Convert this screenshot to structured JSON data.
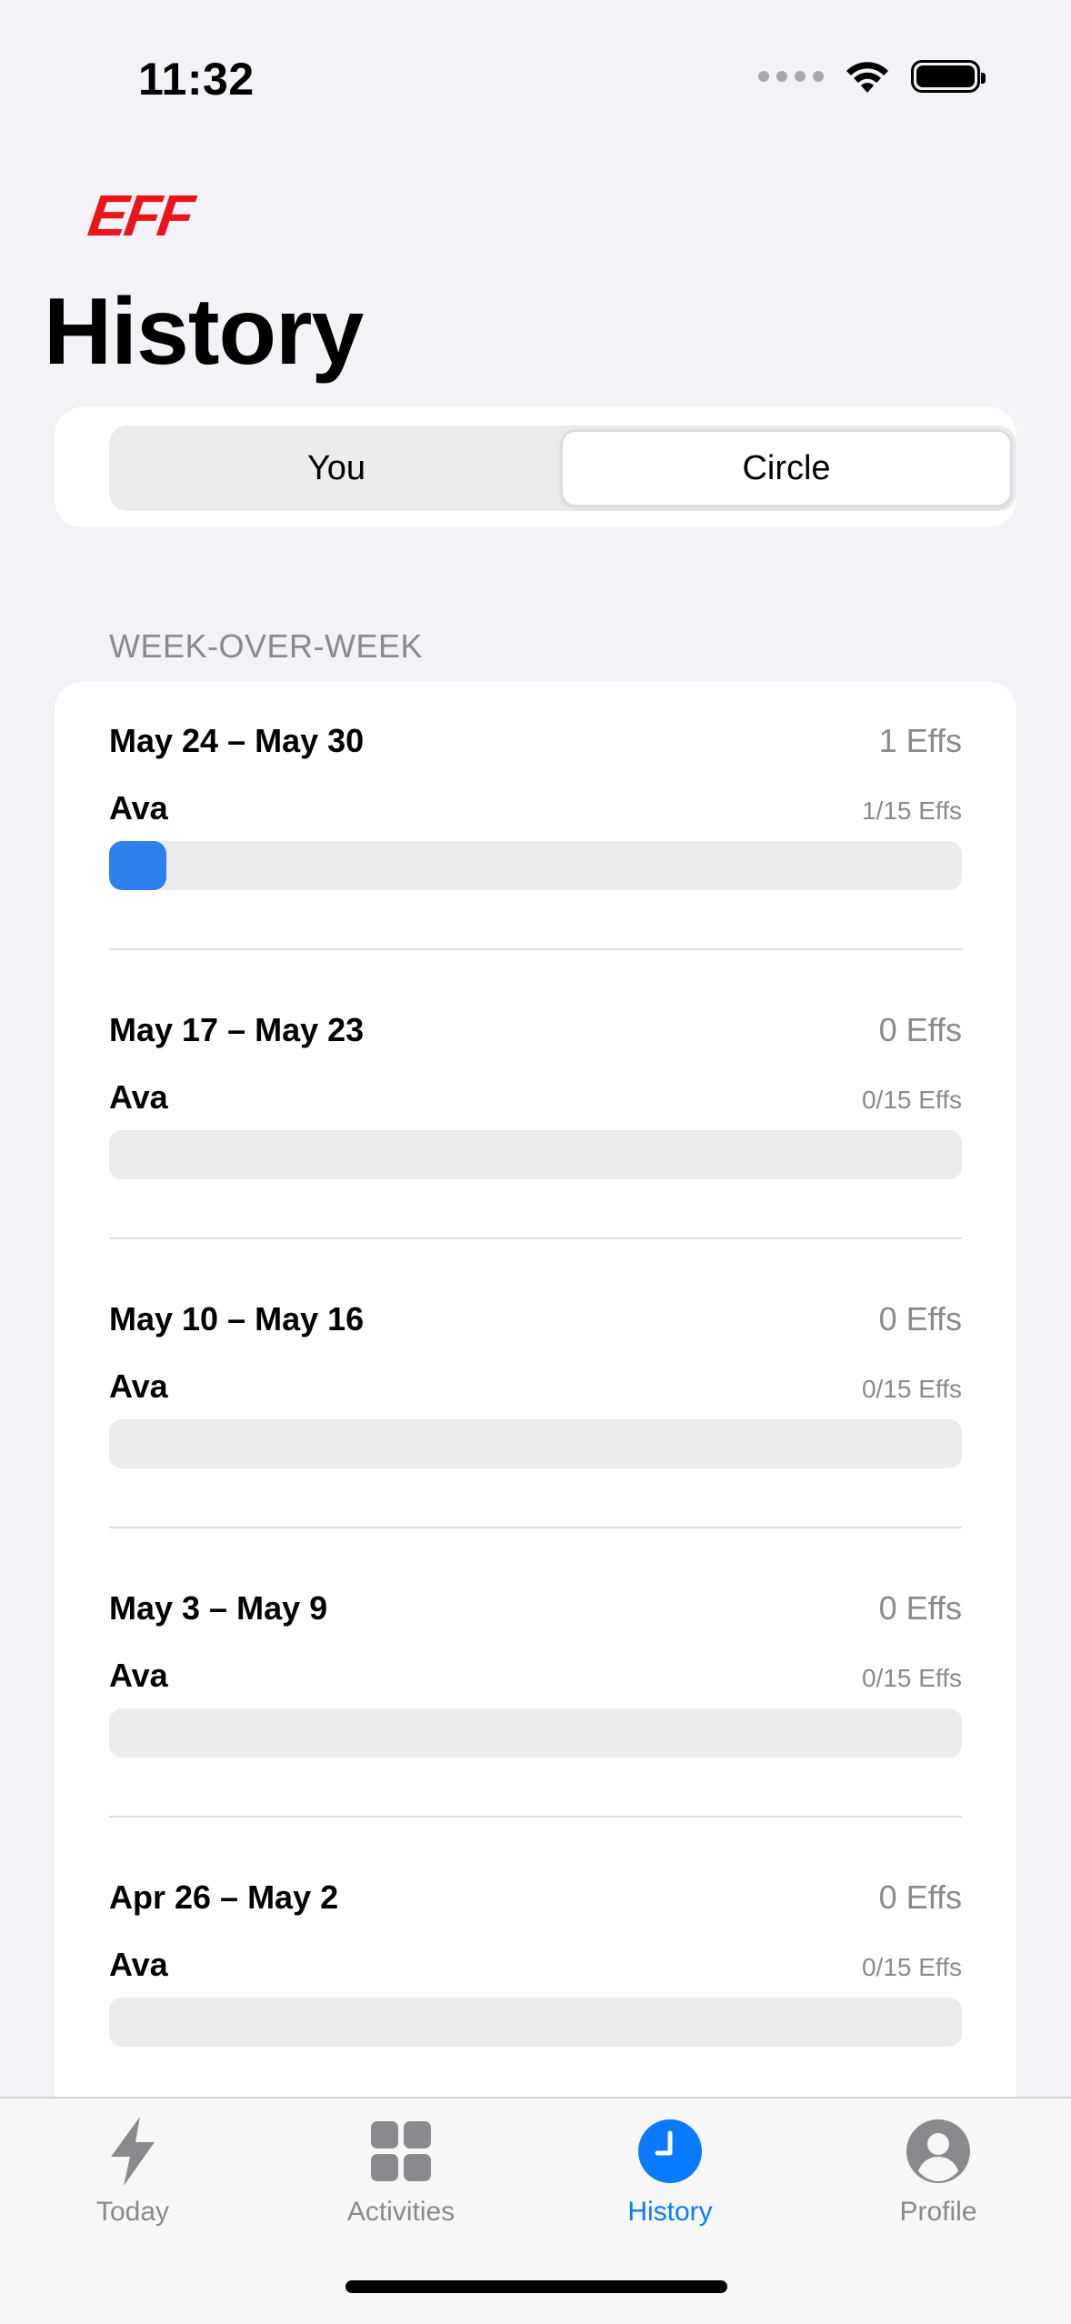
{
  "status": {
    "time": "11:32"
  },
  "brand": {
    "logo": "EFF",
    "color": "#e8151b"
  },
  "page": {
    "title": "History"
  },
  "segments": {
    "options": [
      "You",
      "Circle"
    ],
    "selected": "Circle"
  },
  "section": {
    "header": "WEEK-OVER-WEEK"
  },
  "weeks": [
    {
      "range": "May 24 – May 30",
      "total": "1 Effs",
      "member": "Ava",
      "count": "1/15 Effs",
      "progress": 0.0667
    },
    {
      "range": "May 17 – May 23",
      "total": "0 Effs",
      "member": "Ava",
      "count": "0/15 Effs",
      "progress": 0
    },
    {
      "range": "May 10 – May 16",
      "total": "0 Effs",
      "member": "Ava",
      "count": "0/15 Effs",
      "progress": 0
    },
    {
      "range": "May 3 – May 9",
      "total": "0 Effs",
      "member": "Ava",
      "count": "0/15 Effs",
      "progress": 0
    },
    {
      "range": "Apr 26 – May 2",
      "total": "0 Effs",
      "member": "Ava",
      "count": "0/15 Effs",
      "progress": 0
    }
  ],
  "tabs": [
    {
      "label": "Today",
      "icon": "bolt-icon"
    },
    {
      "label": "Activities",
      "icon": "grid-icon"
    },
    {
      "label": "History",
      "icon": "clock-icon",
      "active": true
    },
    {
      "label": "Profile",
      "icon": "person-icon"
    }
  ],
  "colors": {
    "accent": "#0a7aff",
    "progress": "#2f80ed",
    "background": "#f2f2f7"
  }
}
